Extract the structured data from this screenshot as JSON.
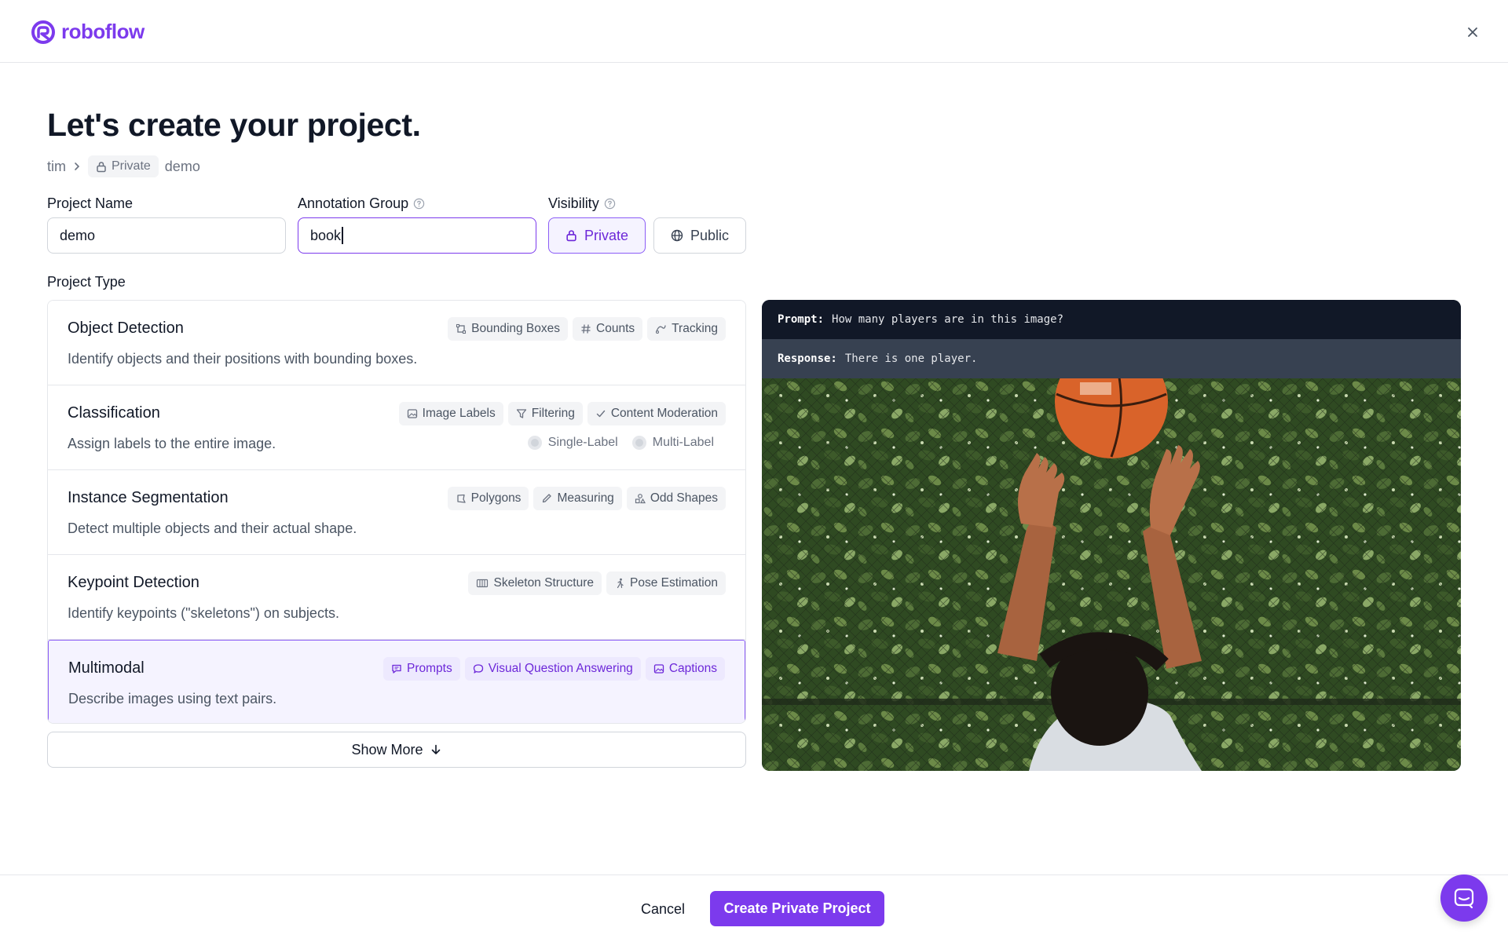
{
  "brand": {
    "name": "roboflow",
    "color": "#7c3aed"
  },
  "page": {
    "title": "Let's create your project."
  },
  "breadcrumb": {
    "workspace": "tim",
    "visibility_badge": "Private",
    "project": "demo"
  },
  "form": {
    "project_name": {
      "label": "Project Name",
      "value": "demo"
    },
    "annotation_group": {
      "label": "Annotation Group",
      "value": "book"
    },
    "visibility": {
      "label": "Visibility",
      "options": [
        "Private",
        "Public"
      ],
      "selected": "Private"
    },
    "project_type_label": "Project Type"
  },
  "project_types": [
    {
      "title": "Object Detection",
      "description": "Identify objects and their positions with bounding boxes.",
      "tags": [
        {
          "label": "Bounding Boxes",
          "icon": "bounding-box-icon"
        },
        {
          "label": "Counts",
          "icon": "hash-icon"
        },
        {
          "label": "Tracking",
          "icon": "tracking-icon"
        }
      ]
    },
    {
      "title": "Classification",
      "description": "Assign labels to the entire image.",
      "tags": [
        {
          "label": "Image Labels",
          "icon": "image-icon"
        },
        {
          "label": "Filtering",
          "icon": "filter-icon"
        },
        {
          "label": "Content Moderation",
          "icon": "check-icon"
        }
      ],
      "options": [
        "Single-Label",
        "Multi-Label"
      ]
    },
    {
      "title": "Instance Segmentation",
      "description": "Detect multiple objects and their actual shape.",
      "tags": [
        {
          "label": "Polygons",
          "icon": "polygon-icon"
        },
        {
          "label": "Measuring",
          "icon": "pencil-icon"
        },
        {
          "label": "Odd Shapes",
          "icon": "shapes-icon"
        }
      ]
    },
    {
      "title": "Keypoint Detection",
      "description": "Identify keypoints (\"skeletons\") on subjects.",
      "tags": [
        {
          "label": "Skeleton Structure",
          "icon": "skeleton-icon"
        },
        {
          "label": "Pose Estimation",
          "icon": "running-person-icon"
        }
      ]
    },
    {
      "title": "Multimodal",
      "description": "Describe images using text pairs.",
      "selected": true,
      "tags": [
        {
          "label": "Prompts",
          "icon": "message-square-icon"
        },
        {
          "label": "Visual Question Answering",
          "icon": "message-circle-icon"
        },
        {
          "label": "Captions",
          "icon": "image-icon"
        }
      ]
    }
  ],
  "show_more": "Show More",
  "preview": {
    "prompt_key": "Prompt:",
    "prompt_text": "How many players are in this image?",
    "response_key": "Response:",
    "response_text": "There is one player."
  },
  "footer": {
    "cancel": "Cancel",
    "create": "Create Private Project"
  }
}
